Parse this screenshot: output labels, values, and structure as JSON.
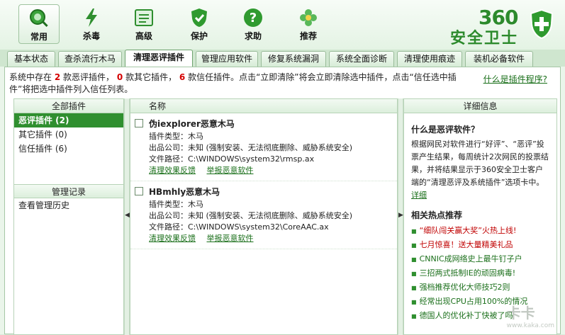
{
  "toolbar": {
    "items": [
      {
        "label": "常用"
      },
      {
        "label": "杀毒"
      },
      {
        "label": "高级"
      },
      {
        "label": "保护"
      },
      {
        "label": "求助"
      },
      {
        "label": "推荐"
      }
    ]
  },
  "logo": {
    "number": "360",
    "name": "安全卫士"
  },
  "tabs": [
    {
      "label": "基本状态"
    },
    {
      "label": "查杀流行木马"
    },
    {
      "label": "清理恶评插件"
    },
    {
      "label": "管理应用软件"
    },
    {
      "label": "修复系统漏洞"
    },
    {
      "label": "系统全面诊断"
    },
    {
      "label": "清理使用痕迹"
    },
    {
      "label": "装机必备软件"
    }
  ],
  "info": {
    "p1": "系统中存在",
    "n1": "2",
    "p2": "款恶评插件，",
    "n2": "0",
    "p3": "款其它插件，",
    "n3": "6",
    "p4": "款信任插件。点击“立即清除”将会立即清除选中插件，点击“信任选中插件”将把选中插件列入信任列表。",
    "help": "什么是插件程序?"
  },
  "left": {
    "header": "全部插件",
    "cats": [
      "恶评插件 (2)",
      "其它插件 (0)",
      "信任插件 (6)"
    ],
    "mgmt_header": "管理记录",
    "mgmt_item": "查看管理历史"
  },
  "middle": {
    "header": "名称",
    "items": [
      {
        "title": "伪iexplorer恶意木马",
        "type": "插件类型：木马",
        "company": "出品公司：未知 (强制安装、无法彻底删除、威胁系统安全)",
        "path": "文件路径：C:\\WINDOWS\\system32\\rmsp.ax",
        "act1": "清理效果反馈",
        "act2": "举报恶意软件"
      },
      {
        "title": "HBmhly恶意木马",
        "type": "插件类型：木马",
        "company": "出品公司：未知 (强制安装、无法彻底删除、威胁系统安全)",
        "path": "文件路径：C:\\WINDOWS\\system32\\CoreAAC.ax",
        "act1": "清理效果反馈",
        "act2": "举报恶意软件"
      }
    ]
  },
  "right": {
    "header": "详细信息",
    "q_title": "什么是恶评软件？",
    "q_body": "根据网民对软件进行“好评”、“恶评”投票产生结果，每周统计2次网民的投票结果，并将结果显示于360安全卫士客户端的“清理恶评及系统插件”选项卡中。",
    "q_link": "详细",
    "hot_title": "相关热点推荐",
    "hot": [
      "“细队闯关赢大奖”火热上线!",
      "七月惊喜！送大量精美礼品",
      "CNNIC成网络史上最牛钉子户",
      "三招两式抵制IE的顽固病毒!",
      "强档推荐优化大师技巧2则",
      "经常出现CPU占用100%的情况",
      "德国人的优化补丁快被了吗"
    ]
  },
  "watermark": {
    "text": "卡卡",
    "url": "www.kaka.com"
  }
}
